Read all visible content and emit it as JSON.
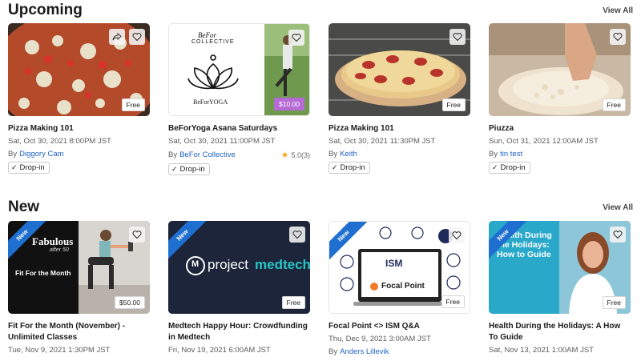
{
  "upcoming": {
    "title": "Upcoming",
    "view_all": "View All",
    "cards": [
      {
        "title": "Pizza Making 101",
        "date": "Sat, Oct 30, 2021 8:00PM JST",
        "by": "By",
        "host": "Diggory Cam",
        "price": "Free",
        "tag": "Drop-in",
        "check": "✓"
      },
      {
        "title": "BeForYoga Asana Saturdays",
        "date": "Sat, Oct 30, 2021 11:00PM JST",
        "by": "By",
        "host": "BeFor Collective",
        "price": "$10.00",
        "tag": "Drop-in",
        "check": "✓",
        "rating": "5.0",
        "rating_count": "(3)",
        "brand_top": "BeFor",
        "brand_sub": "COLLECTIVE",
        "brand_bottom": "BeForYOGA"
      },
      {
        "title": "Pizza Making 101",
        "date": "Sat, Oct 30, 2021 11:30PM JST",
        "by": "By",
        "host": "Keith",
        "price": "Free",
        "tag": "Drop-in",
        "check": "✓"
      },
      {
        "title": "Piuzza",
        "date": "Sun, Oct 31, 2021 12:00AM JST",
        "by": "By",
        "host": "tin test",
        "price": "Free",
        "tag": "Drop-in",
        "check": "✓"
      }
    ]
  },
  "new": {
    "title": "New",
    "view_all": "View All",
    "ribbon": "New",
    "cards": [
      {
        "title": "Fit For the Month (November) - Unlimited Classes",
        "date": "Tue, Nov 9, 2021 1:30PM JST",
        "price": "$50.00",
        "brand": "Fabulous",
        "brand_sub": "after 50",
        "thumb_caption": "Fit For the Month"
      },
      {
        "title": "Medtech Happy Hour: Crowdfunding in Medtech",
        "date": "Fri, Nov 19, 2021 6:00AM JST",
        "price": "Free",
        "brand_a": "project",
        "brand_b": "medtech",
        "brand_mark": "M"
      },
      {
        "title": "Focal Point <> ISM Q&A",
        "date": "Thu, Dec 9, 2021 3:00AM JST",
        "by": "By",
        "host": "Anders Lillevik",
        "price": "Free",
        "brand_a": "ISM",
        "brand_b": "Focal Point"
      },
      {
        "title": "Health During the Holidays: A How To Guide",
        "date": "Sat, Nov 13, 2021 1:00AM JST",
        "price": "Free",
        "thumb_title": "Health During the Holidays: How to Guide"
      }
    ]
  },
  "colors": {
    "link": "#1f63c6",
    "ribbon": "#1f6fd1",
    "star": "#f0a81c"
  }
}
